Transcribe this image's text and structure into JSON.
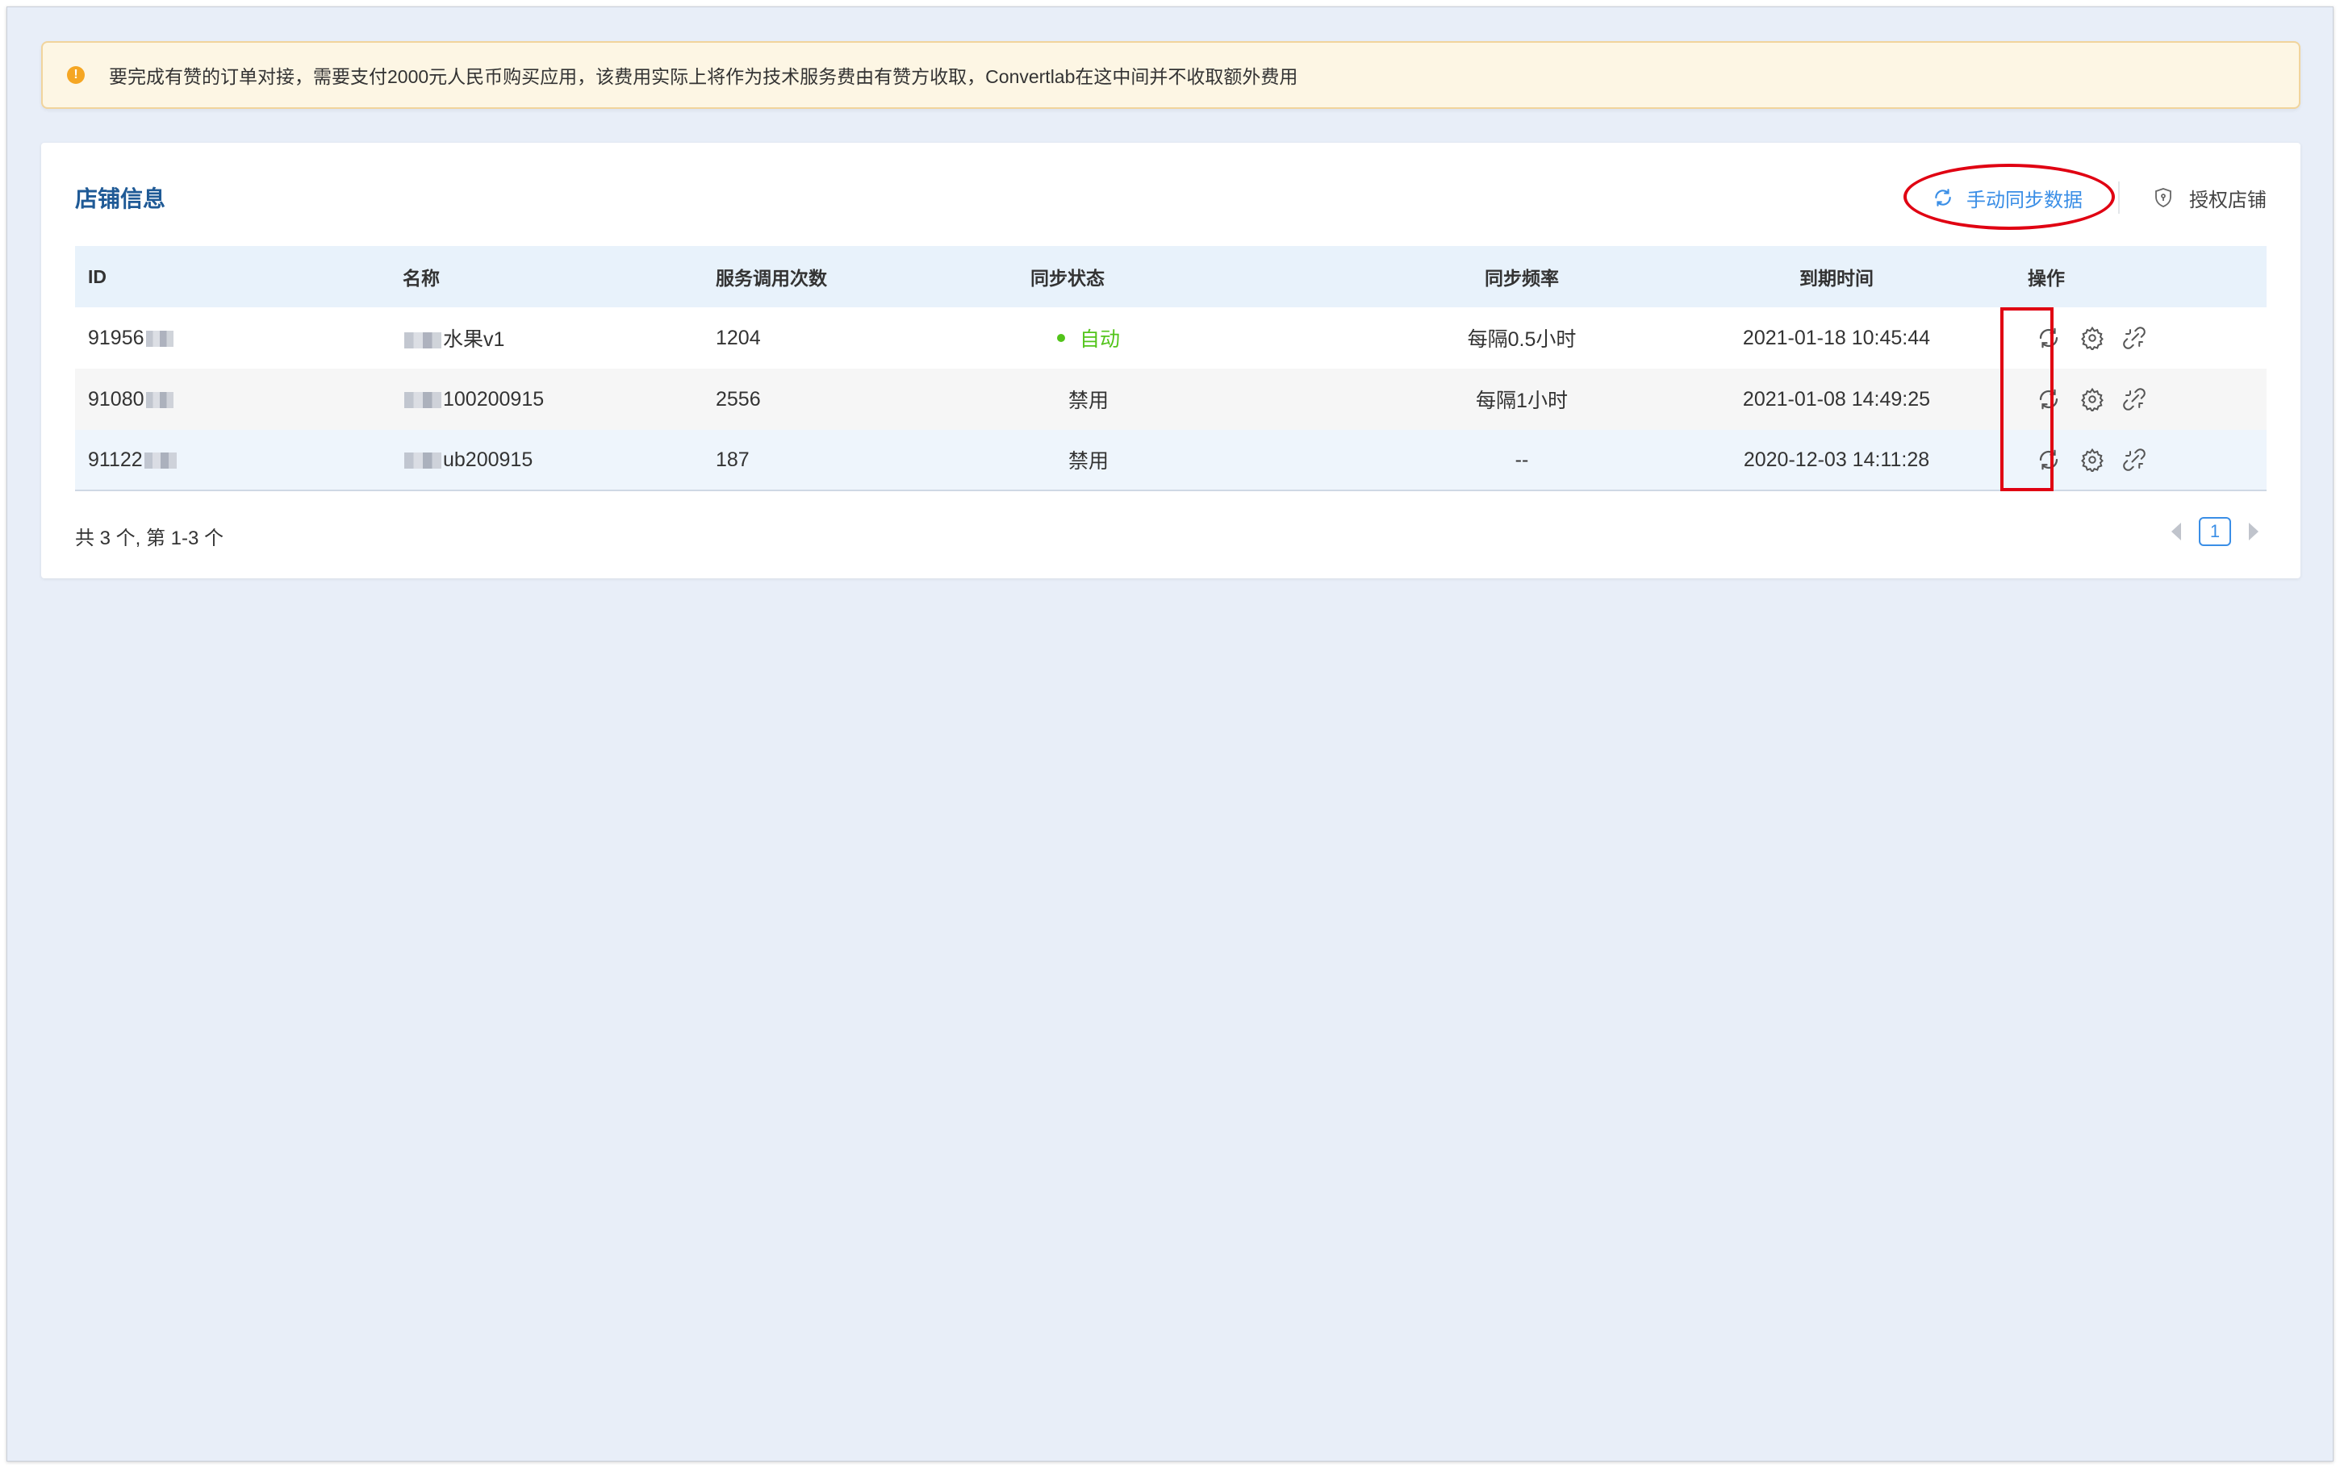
{
  "alert": {
    "text": "要完成有赞的订单对接，需要支付2000元人民币购买应用，该费用实际上将作为技术服务费由有赞方收取，Convertlab在这中间并不收取额外费用",
    "icon": "warning-icon",
    "color": "#f5a623"
  },
  "card": {
    "title": "店铺信息",
    "manual_sync_label": "手动同步数据",
    "authorize_label": "授权店铺"
  },
  "table": {
    "headers": {
      "id": "ID",
      "name": "名称",
      "calls": "服务调用次数",
      "status": "同步状态",
      "frequency": "同步频率",
      "expiry": "到期时间",
      "ops": "操作"
    },
    "rows": [
      {
        "id": "91956",
        "name": "水果v1",
        "calls": "1204",
        "status": "自动",
        "frequency": "每隔0.5小时",
        "expiry": "2021-01-18 10:45:44"
      },
      {
        "id": "91080",
        "name": "100200915",
        "calls": "2556",
        "status": "禁用",
        "frequency": "每隔1小时",
        "expiry": "2021-01-08 14:49:25"
      },
      {
        "id": "91122",
        "name": "ub200915",
        "calls": "187",
        "status": "禁用",
        "frequency": "--",
        "expiry": "2020-12-03 14:11:28"
      }
    ],
    "row_actions": [
      "sync-icon",
      "settings-icon",
      "link-icon"
    ]
  },
  "footer": {
    "total": "共 3 个, 第 1-3 个",
    "current_page": "1"
  },
  "colors": {
    "accent": "#3a8ee6",
    "title": "#1f5a96",
    "status_auto": "#52c41a",
    "highlight": "#e00012",
    "alert_bg": "#fdf6e4"
  }
}
